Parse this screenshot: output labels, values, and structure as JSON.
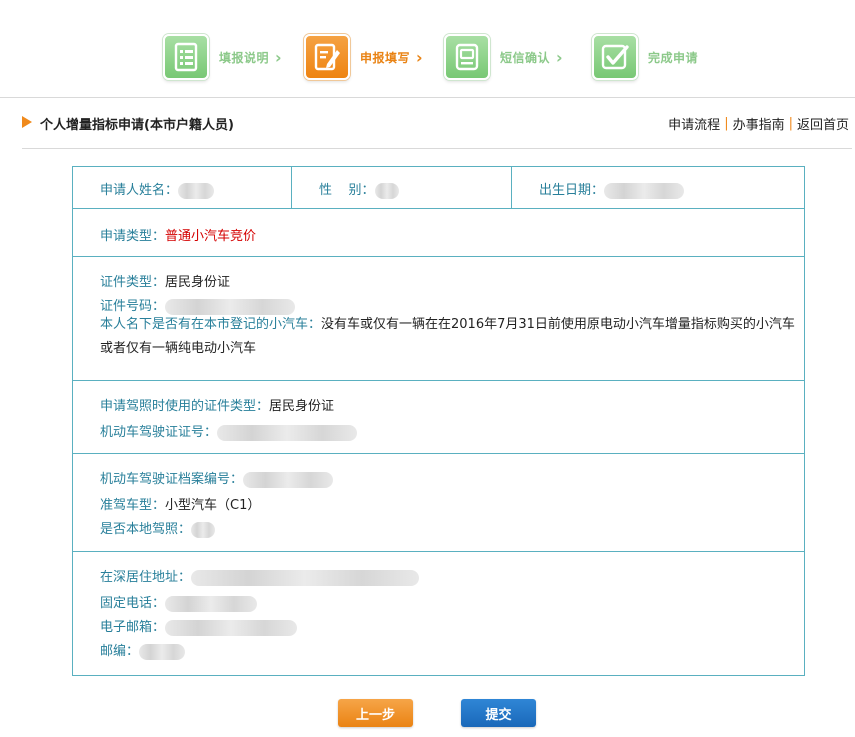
{
  "steps": [
    {
      "label": "填报说明",
      "icon": "document-list-icon",
      "state": "done"
    },
    {
      "label": "申报填写",
      "icon": "edit-form-icon",
      "state": "active"
    },
    {
      "label": "短信确认",
      "icon": "sms-message-icon",
      "state": "done"
    },
    {
      "label": "完成申请",
      "icon": "checkmark-icon",
      "state": "done"
    }
  ],
  "step_arrow": "›",
  "header": {
    "title": "个人增量指标申请(本市户籍人员)",
    "links": [
      "申请流程",
      "办事指南",
      "返回首页"
    ],
    "separator": "|"
  },
  "info": {
    "name_label": "申请人姓名：",
    "gender_label": "性    别：",
    "birth_label": "出生日期：",
    "apply_type_label": "申请类型：",
    "apply_type_value": "普通小汽车竞价",
    "id_type_label": "证件类型：",
    "id_type_value": "居民身份证",
    "id_number_label": "证件号码：",
    "car_question_label": "本人名下是否有在本市登记的小汽车：",
    "car_question_value": "没有车或仅有一辆在在2016年7月31日前使用原电动小汽车增量指标购买的小汽车或者仅有一辆纯电动小汽车",
    "license_id_type_label": "申请驾照时使用的证件类型：",
    "license_id_type_value": "居民身份证",
    "license_number_label": "机动车驾驶证证号：",
    "license_file_label": "机动车驾驶证档案编号：",
    "vehicle_class_label": "准驾车型：",
    "vehicle_class_value": "小型汽车（C1）",
    "local_license_label": "是否本地驾照：",
    "address_label": "在深居住地址：",
    "phone_label": "固定电话：",
    "email_label": "电子邮箱：",
    "zip_label": "邮编："
  },
  "buttons": {
    "prev": "上一步",
    "submit": "提交"
  },
  "colors": {
    "accent_orange": "#ee8412",
    "step_green": "#78c874",
    "label_teal": "#287f9a",
    "border_teal": "#5ab0c0",
    "submit_blue": "#1a68b9",
    "highlight_red": "#d40000"
  }
}
